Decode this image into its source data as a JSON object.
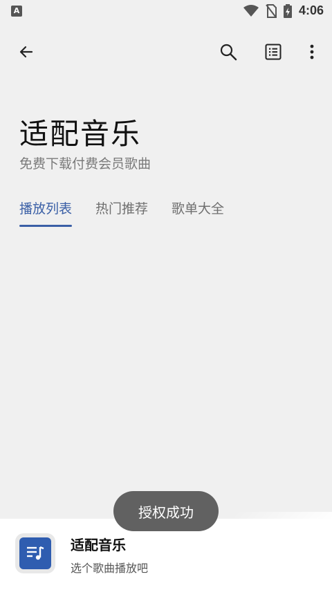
{
  "status_bar": {
    "time": "4:06",
    "left_icon_letter": "A"
  },
  "toolbar": {
    "back_icon": "arrow-left-icon",
    "search_icon": "search-icon",
    "list_icon": "list-icon",
    "more_icon": "more-vert-icon"
  },
  "header": {
    "title": "适配音乐",
    "subtitle": "免费下载付费会员歌曲"
  },
  "tabs": [
    {
      "label": "播放列表",
      "active": true
    },
    {
      "label": "热门推荐",
      "active": false
    },
    {
      "label": "歌单大全",
      "active": false
    }
  ],
  "toast": {
    "text": "授权成功"
  },
  "player": {
    "title": "适配音乐",
    "subtitle": "选个歌曲播放吧"
  },
  "colors": {
    "accent": "#3a5fa6",
    "album": "#2f5db0",
    "background": "#f0f0f0"
  }
}
